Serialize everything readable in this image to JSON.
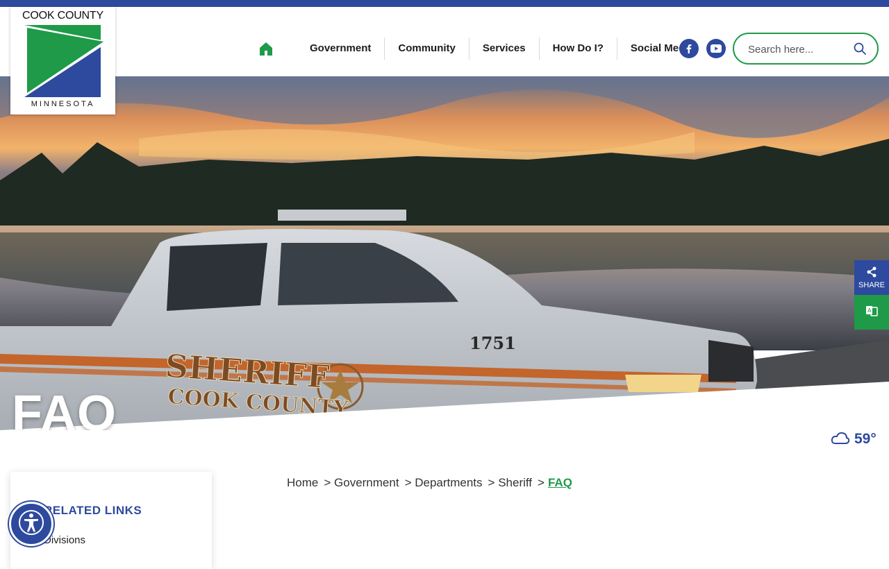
{
  "brand": {
    "name_top": "COOK COUNTY",
    "name_bottom": "MINNESOTA",
    "colors": {
      "blue": "#2e4a9e",
      "green": "#1f9a48"
    }
  },
  "nav": {
    "home_icon": "home-icon",
    "items": [
      {
        "label": "Government"
      },
      {
        "label": "Community"
      },
      {
        "label": "Services"
      },
      {
        "label": "How Do I?"
      },
      {
        "label": "Social Media"
      }
    ],
    "social": [
      "facebook-icon",
      "youtube-icon"
    ]
  },
  "search": {
    "placeholder": "Search here..."
  },
  "hero": {
    "title": "FAQ",
    "truck_text_1": "SHERIFF",
    "truck_text_2": "COOK COUNTY",
    "truck_number": "1751"
  },
  "side_tabs": {
    "share_label": "SHARE"
  },
  "weather": {
    "temp": "59°",
    "icon": "cloud-icon"
  },
  "sidebar": {
    "title": "RELATED LINKS",
    "links": [
      {
        "label": "Divisions"
      }
    ]
  },
  "breadcrumb": {
    "items": [
      {
        "label": "Home"
      },
      {
        "label": "> Government"
      },
      {
        "label": "> Departments"
      },
      {
        "label": "> Sheriff"
      }
    ],
    "current_prefix": ">",
    "current": "FAQ"
  }
}
